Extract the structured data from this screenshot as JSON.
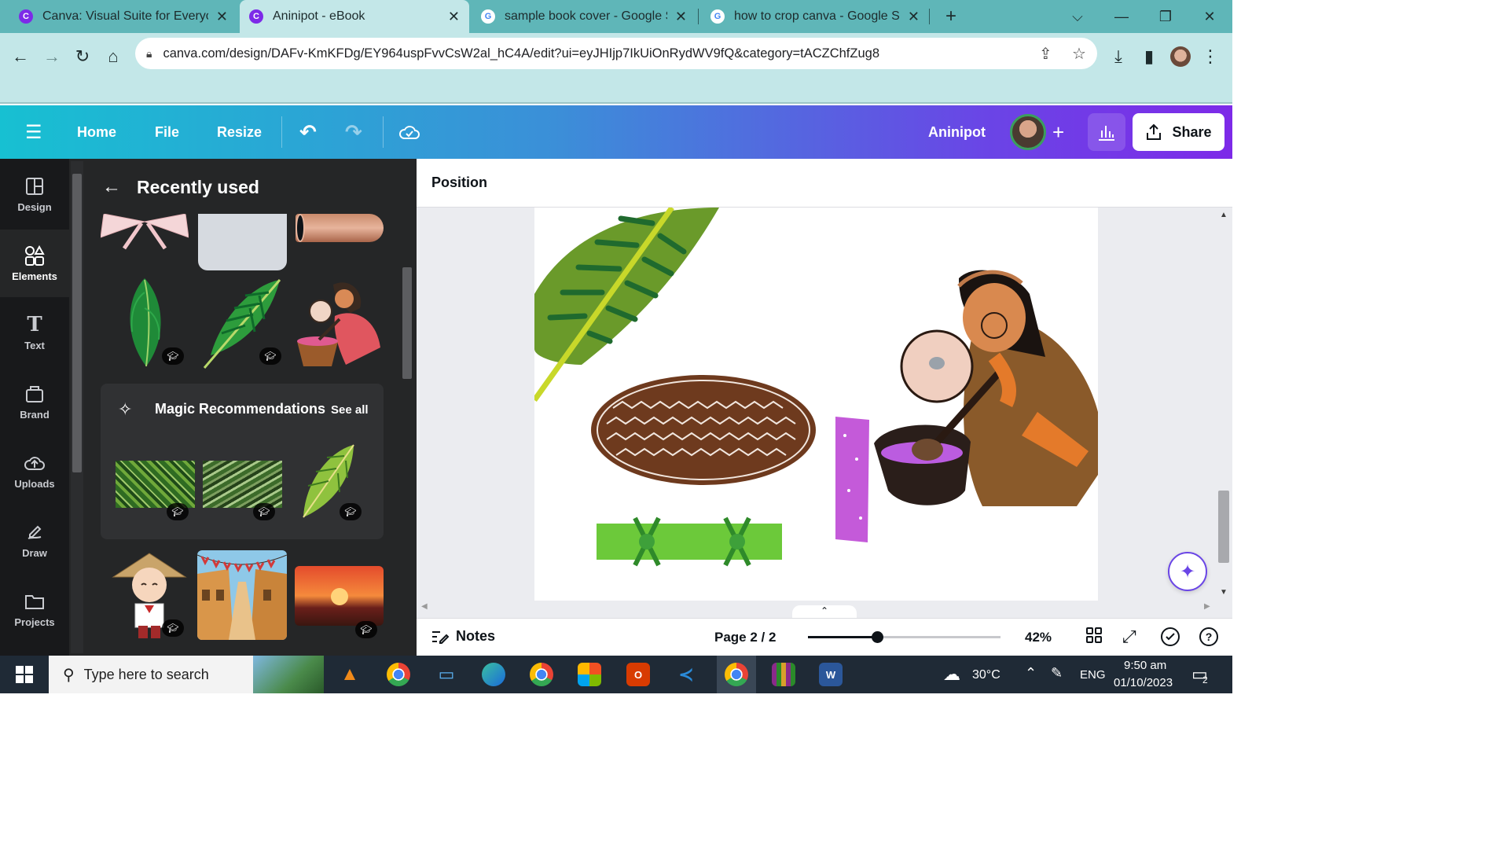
{
  "browser": {
    "tabs": [
      {
        "title": "Canva: Visual Suite for Everyone",
        "active": false
      },
      {
        "title": "Aninipot - eBook",
        "active": true
      },
      {
        "title": "sample book cover - Google Sea",
        "active": false
      },
      {
        "title": "how to crop canva - Google Sea",
        "active": false
      }
    ],
    "new_tab": "+",
    "url": "canva.com/design/DAFv-KmKFDg/EY964uspFvvCsW2al_hC4A/edit?ui=eyJHIjp7IkUiOnRydWV9fQ&category=tACZChfZug8"
  },
  "header": {
    "menu": [
      "Home",
      "File",
      "Resize"
    ],
    "design_title": "Aninipot",
    "share_label": "Share"
  },
  "rail": {
    "items": [
      {
        "label": "Design",
        "icon": "layout-icon"
      },
      {
        "label": "Elements",
        "icon": "elements-icon"
      },
      {
        "label": "Text",
        "icon": "text-icon"
      },
      {
        "label": "Brand",
        "icon": "brand-icon"
      },
      {
        "label": "Uploads",
        "icon": "upload-cloud-icon"
      },
      {
        "label": "Draw",
        "icon": "draw-icon"
      },
      {
        "label": "Projects",
        "icon": "folder-icon"
      }
    ],
    "active": "Elements"
  },
  "panel": {
    "title": "Recently used",
    "magic": {
      "title": "Magic Recommendations",
      "see_all": "See all"
    }
  },
  "editor": {
    "context_label": "Position"
  },
  "footer": {
    "notes_label": "Notes",
    "page_info": "Page 2 / 2",
    "zoom_value": "42%",
    "zoom_fraction": 0.36
  },
  "taskbar": {
    "search_placeholder": "Type here to search",
    "weather": "30°C",
    "language": "ENG",
    "time": "9:50 am",
    "date": "01/10/2023",
    "notification_count": "2"
  },
  "colors": {
    "tab_bar": "#5fb6b8",
    "address_bar": "#c3e7e8",
    "header_start": "#17c0d2",
    "header_end": "#7d2ae8",
    "rail_bg": "#18191b",
    "panel_bg": "#252627",
    "editor_bg": "#ebecf0"
  }
}
